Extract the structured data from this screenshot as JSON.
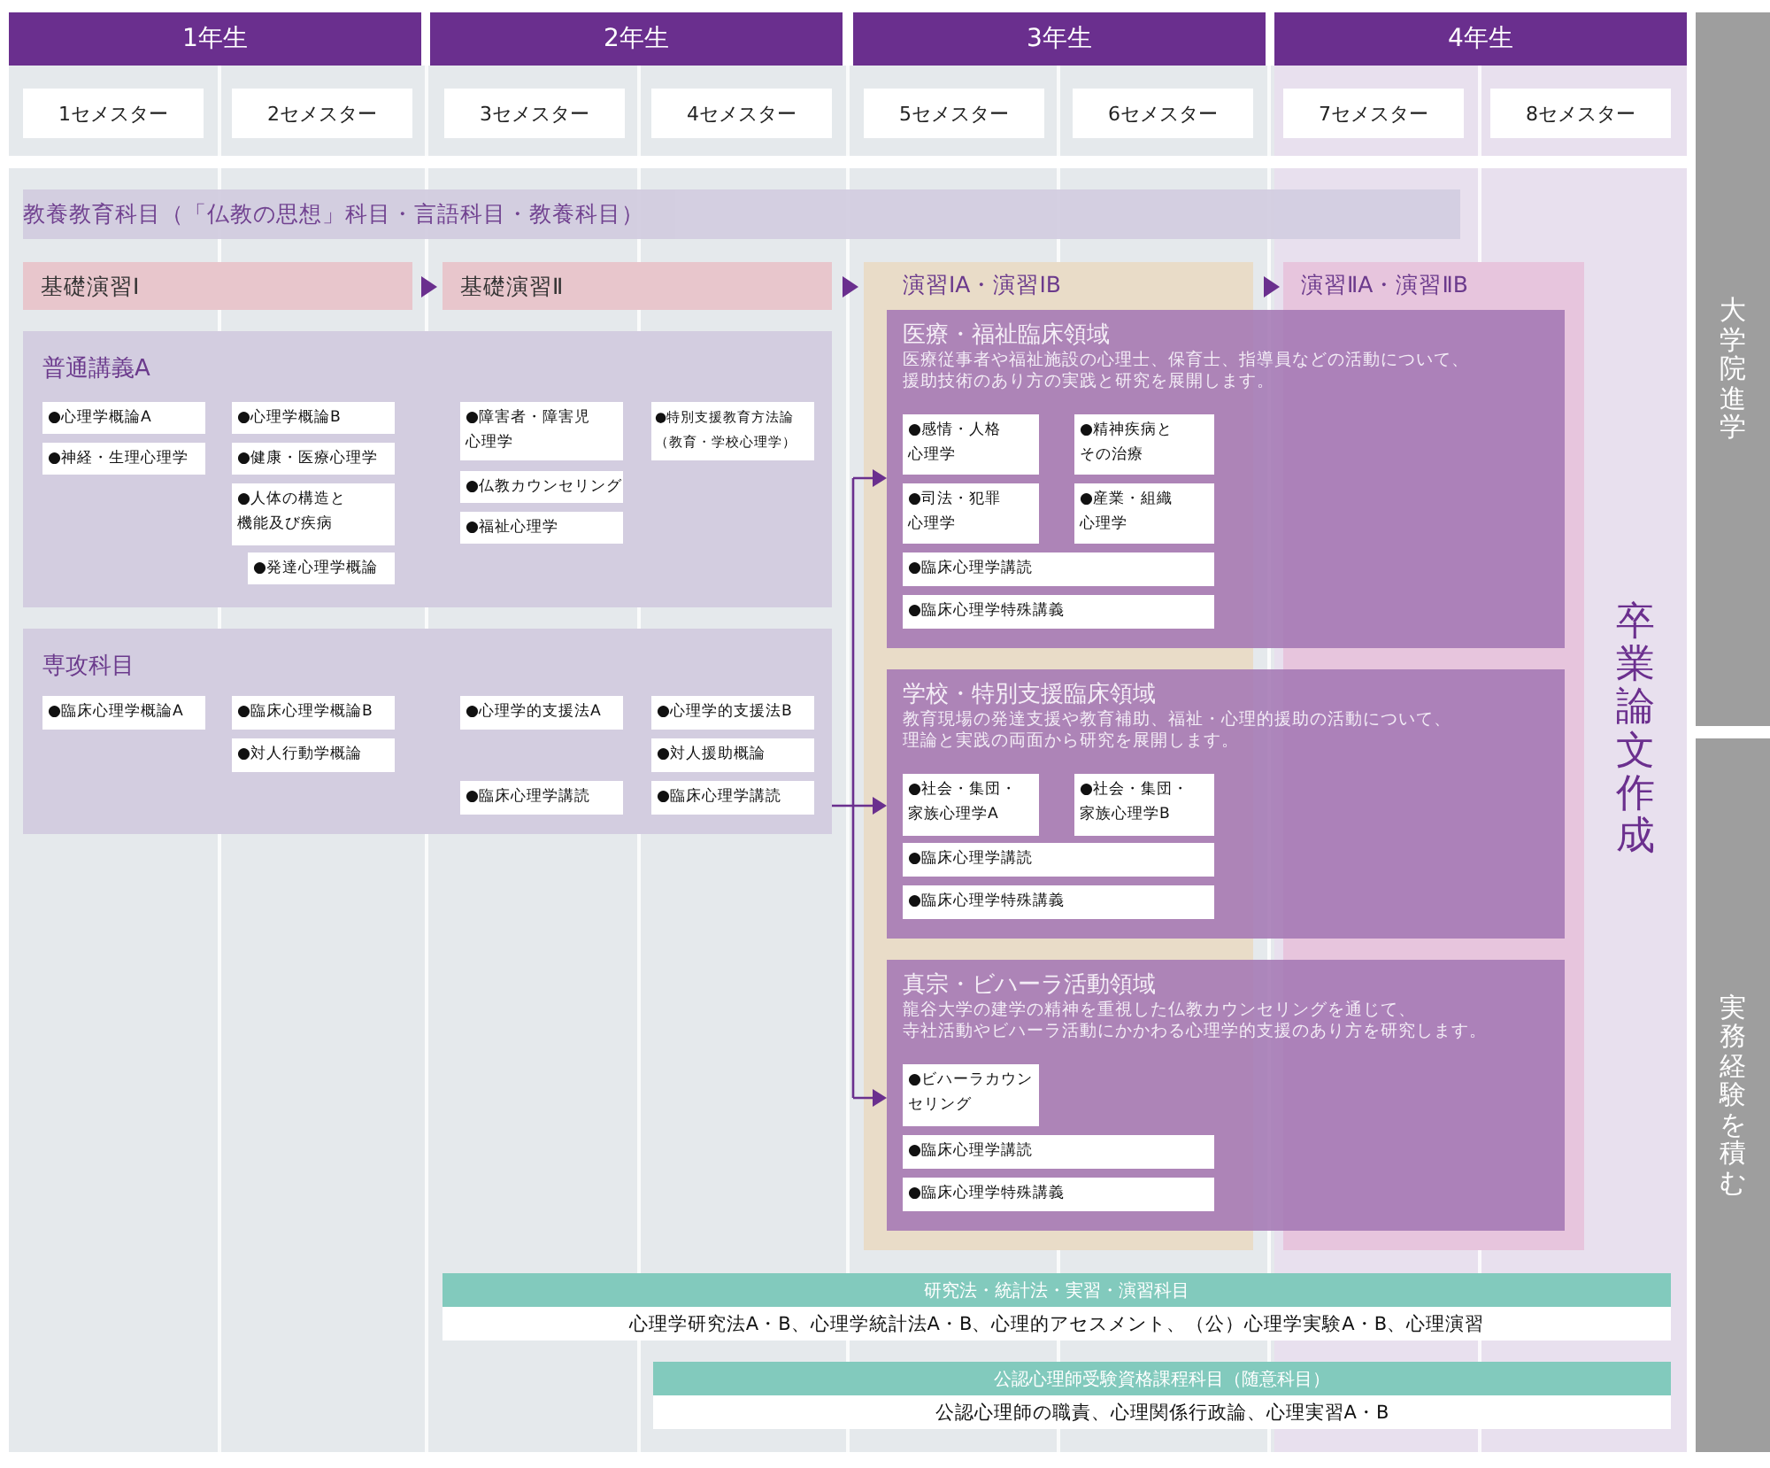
{
  "years": [
    {
      "label": "1年生",
      "semesters": [
        "1セメスター",
        "2セメスター"
      ]
    },
    {
      "label": "2年生",
      "semesters": [
        "3セメスター",
        "4セメスター"
      ]
    },
    {
      "label": "3年生",
      "semesters": [
        "5セメスター",
        "6セメスター"
      ]
    },
    {
      "label": "4年生",
      "semesters": [
        "7セメスター",
        "8セメスター"
      ]
    }
  ],
  "side_labels": [
    "大学院進学",
    "実務経験を積む"
  ],
  "liberal_arts": "教養教育科目（「仏教の思想」科目・言語科目・教養科目）",
  "seminars": [
    "基礎演習Ⅰ",
    "基礎演習Ⅱ",
    "演習ⅠA・演習ⅠB",
    "演習ⅡA・演習ⅡB"
  ],
  "course_groups": [
    {
      "title": "普通講義A",
      "courses": [
        "●心理学概論A",
        "●神経・生理心理学",
        "●心理学概論B",
        "●健康・医療心理学",
        "●人体の構造と機能及び疾病",
        "●発達心理学概論",
        "●障害者・障害児心理学",
        "●仏教カウンセリング",
        "●福祉心理学",
        "●特別支援教育方法論（教育・学校心理学）"
      ]
    },
    {
      "title": "専攻科目",
      "courses": [
        "●臨床心理学概論A",
        "●臨床心理学概論B",
        "●対人行動学概論",
        "●心理学的支援法A",
        "●臨床心理学講読",
        "●心理学的支援法B",
        "●対人援助概論",
        "●臨床心理学講読"
      ]
    }
  ],
  "domains": [
    {
      "title": "医療・福祉臨床領域",
      "description": [
        "医療従事者や福祉施設の心理士、保育士、指導員などの活動について、",
        "援助技術のあり方の実践と研究を展開します。"
      ],
      "courses": [
        "●感情・人格心理学",
        "●精神疾病とその治療",
        "●司法・犯罪心理学",
        "●産業・組織心理学",
        "●臨床心理学講読",
        "●臨床心理学特殊講義"
      ]
    },
    {
      "title": "学校・特別支援臨床領域",
      "description": [
        "教育現場の発達支援や教育補助、福祉・心理的援助の活動について、",
        "理論と実践の両面から研究を展開します。"
      ],
      "courses": [
        "●社会・集団・家族心理学A",
        "●社会・集団・家族心理学B",
        "●臨床心理学講読",
        "●臨床心理学特殊講義"
      ]
    },
    {
      "title": "真宗・ビハーラ活動領域",
      "description": [
        "龍谷大学の建学の精神を重視した仏教カウンセリングを通じて、",
        "寺社活動やビハーラ活動にかかわる心理学的支援のあり方を研究します。"
      ],
      "courses": [
        "●ビハーラカウンセリング",
        "●臨床心理学講読",
        "●臨床心理学特殊講義"
      ]
    }
  ],
  "thesis": "卒業論文作成",
  "bottom_bars": [
    {
      "title": "研究法・統計法・実習・演習科目",
      "courses": "心理学研究法A・B、心理学統計法A・B、心理的アセスメント、（公）心理学実験A・B、心理演習"
    },
    {
      "title": "公認心理師受験資格課程科目（随意科目）",
      "courses": "公認心理師の職責、心理関係行政論、心理実習A・B"
    }
  ]
}
